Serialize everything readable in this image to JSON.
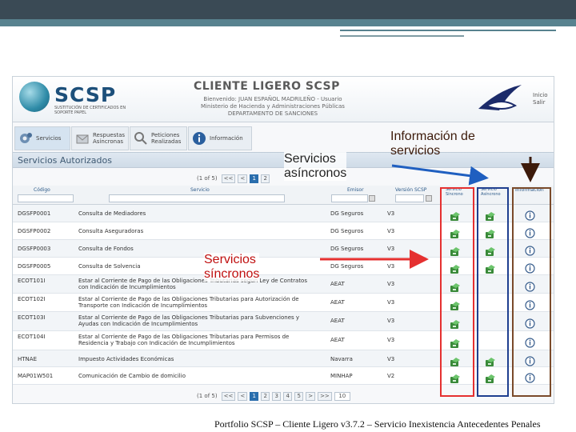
{
  "app": {
    "logo_text": "SCSP",
    "logo_sub": "SUSTITUCIÓN DE CERTIFICADOS EN SOPORTE PAPEL",
    "title": "CLIENTE LIGERO SCSP",
    "welcome": "Bienvenido: JUAN ESPAÑOL MADRILEÑO - Usuario",
    "ministry": "Ministerio de Hacienda y Administraciones Públicas",
    "department": "DEPARTAMENTO DE SANCIONES",
    "link_inicio": "Inicio",
    "link_salir": "Salir"
  },
  "tabs": [
    {
      "line1": "Servicios",
      "line2": "",
      "icon": "gear-icon"
    },
    {
      "line1": "Respuestas",
      "line2": "Asíncronas",
      "icon": "inbox-icon"
    },
    {
      "line1": "Peticiones",
      "line2": "Realizadas",
      "icon": "magnifier-icon"
    },
    {
      "line1": "Información",
      "line2": "",
      "icon": "info-icon"
    }
  ],
  "section_title": "Servicios Autorizados",
  "pager": {
    "count": "(1 of 5)",
    "first": "<<",
    "prev": "<",
    "pages": [
      "1",
      "2",
      "3",
      "4",
      "5"
    ],
    "next": ">",
    "last": ">>",
    "rows_value": "10"
  },
  "columns": {
    "code": "Código",
    "service": "Servicio",
    "emisor": "Emisor",
    "version": "Versión SCSP",
    "sync": "Servicio Síncrono",
    "async": "Servicio Asíncrono",
    "info": "Información"
  },
  "rows": [
    {
      "code": "DGSFP0001",
      "l1": "Consulta de Mediadores",
      "l2": "",
      "emisor": "DG Seguros",
      "ver": "V3",
      "sync": true,
      "async": true
    },
    {
      "code": "DGSFP0002",
      "l1": "Consulta Aseguradoras",
      "l2": "",
      "emisor": "DG Seguros",
      "ver": "V3",
      "sync": true,
      "async": true
    },
    {
      "code": "DGSFP0003",
      "l1": "Consulta de Fondos",
      "l2": "",
      "emisor": "DG Seguros",
      "ver": "V3",
      "sync": true,
      "async": true
    },
    {
      "code": "DGSFP0005",
      "l1": "Consulta de Solvencia",
      "l2": "",
      "emisor": "DG Seguros",
      "ver": "V3",
      "sync": true,
      "async": true
    },
    {
      "code": "ECOT101I",
      "l1": "Estar al Corriente de Pago de las Obligaciones Tributarias según Ley de Contratos",
      "l2": "con Indicación de Incumplimientos",
      "emisor": "AEAT",
      "ver": "V3",
      "sync": true,
      "async": false
    },
    {
      "code": "ECOT102I",
      "l1": "Estar al Corriente de Pago de las Obligaciones Tributarias para Autorización de",
      "l2": "Transporte con Indicación de Incumplimientos",
      "emisor": "AEAT",
      "ver": "V3",
      "sync": true,
      "async": false
    },
    {
      "code": "ECOT103I",
      "l1": "Estar al Corriente de Pago de las Obligaciones Tributarias para Subvenciones y",
      "l2": "Ayudas con Indicación de Incumplimientos",
      "emisor": "AEAT",
      "ver": "V3",
      "sync": true,
      "async": false
    },
    {
      "code": "ECOT104I",
      "l1": "Estar al Corriente de Pago de las Obligaciones Tributarias para Permisos de",
      "l2": "Residencia y Trabajo con Indicación de Incumplimientos",
      "emisor": "AEAT",
      "ver": "V3",
      "sync": true,
      "async": false
    },
    {
      "code": "HTNAE",
      "l1": "Impuesto Actividades Económicas",
      "l2": "",
      "emisor": "Navarra",
      "ver": "V3",
      "sync": true,
      "async": true
    },
    {
      "code": "MAP01W501",
      "l1": "Comunicación de Cambio de domicilio",
      "l2": "",
      "emisor": "MINHAP",
      "ver": "V2",
      "sync": true,
      "async": true
    }
  ],
  "annotations": {
    "async_label_line1": "Servicios",
    "async_label_line2": "asíncronos",
    "info_label_line1": "Información de",
    "info_label_line2": "servicios",
    "sync_label_line1": "Servicios",
    "sync_label_line2": "síncronos"
  },
  "footer": "Portfolio SCSP – Cliente Ligero v3.7.2 – Servicio Inexistencia Antecedentes Penales",
  "colors": {
    "sync_box": "#e53030",
    "async_box": "#1f3f8f",
    "info_box": "#7a4a2a",
    "arrow_red": "#e53030",
    "arrow_blue": "#1f5fc0",
    "arrow_dark": "#3c1a0a"
  }
}
